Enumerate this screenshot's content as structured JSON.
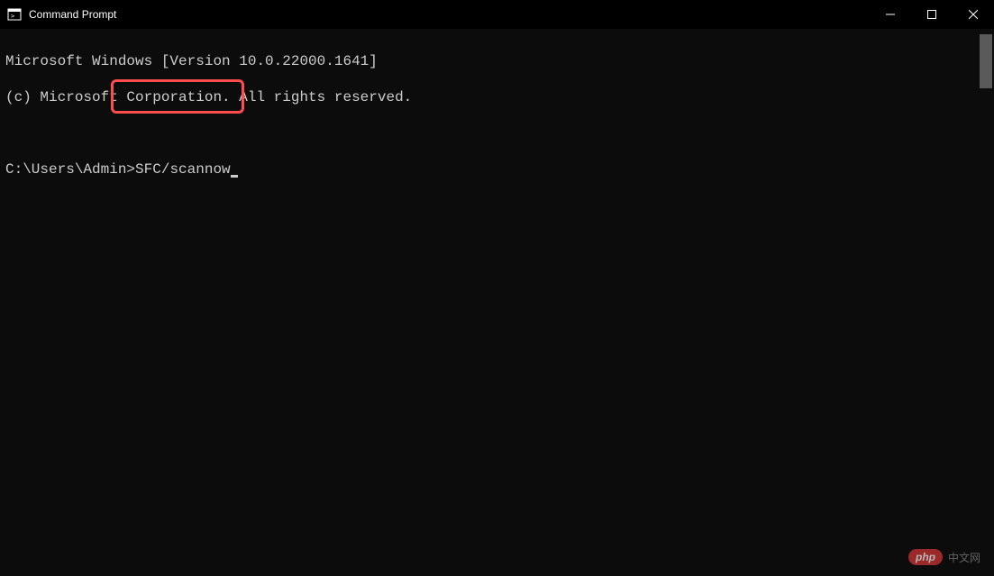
{
  "titlebar": {
    "title": "Command Prompt"
  },
  "terminal": {
    "line1": "Microsoft Windows [Version 10.0.22000.1641]",
    "line2": "(c) Microsoft Corporation. All rights reserved.",
    "prompt": "C:\\Users\\Admin>",
    "command": "SFC/scannow"
  },
  "watermark": {
    "badge": "php",
    "text": "中文网"
  }
}
